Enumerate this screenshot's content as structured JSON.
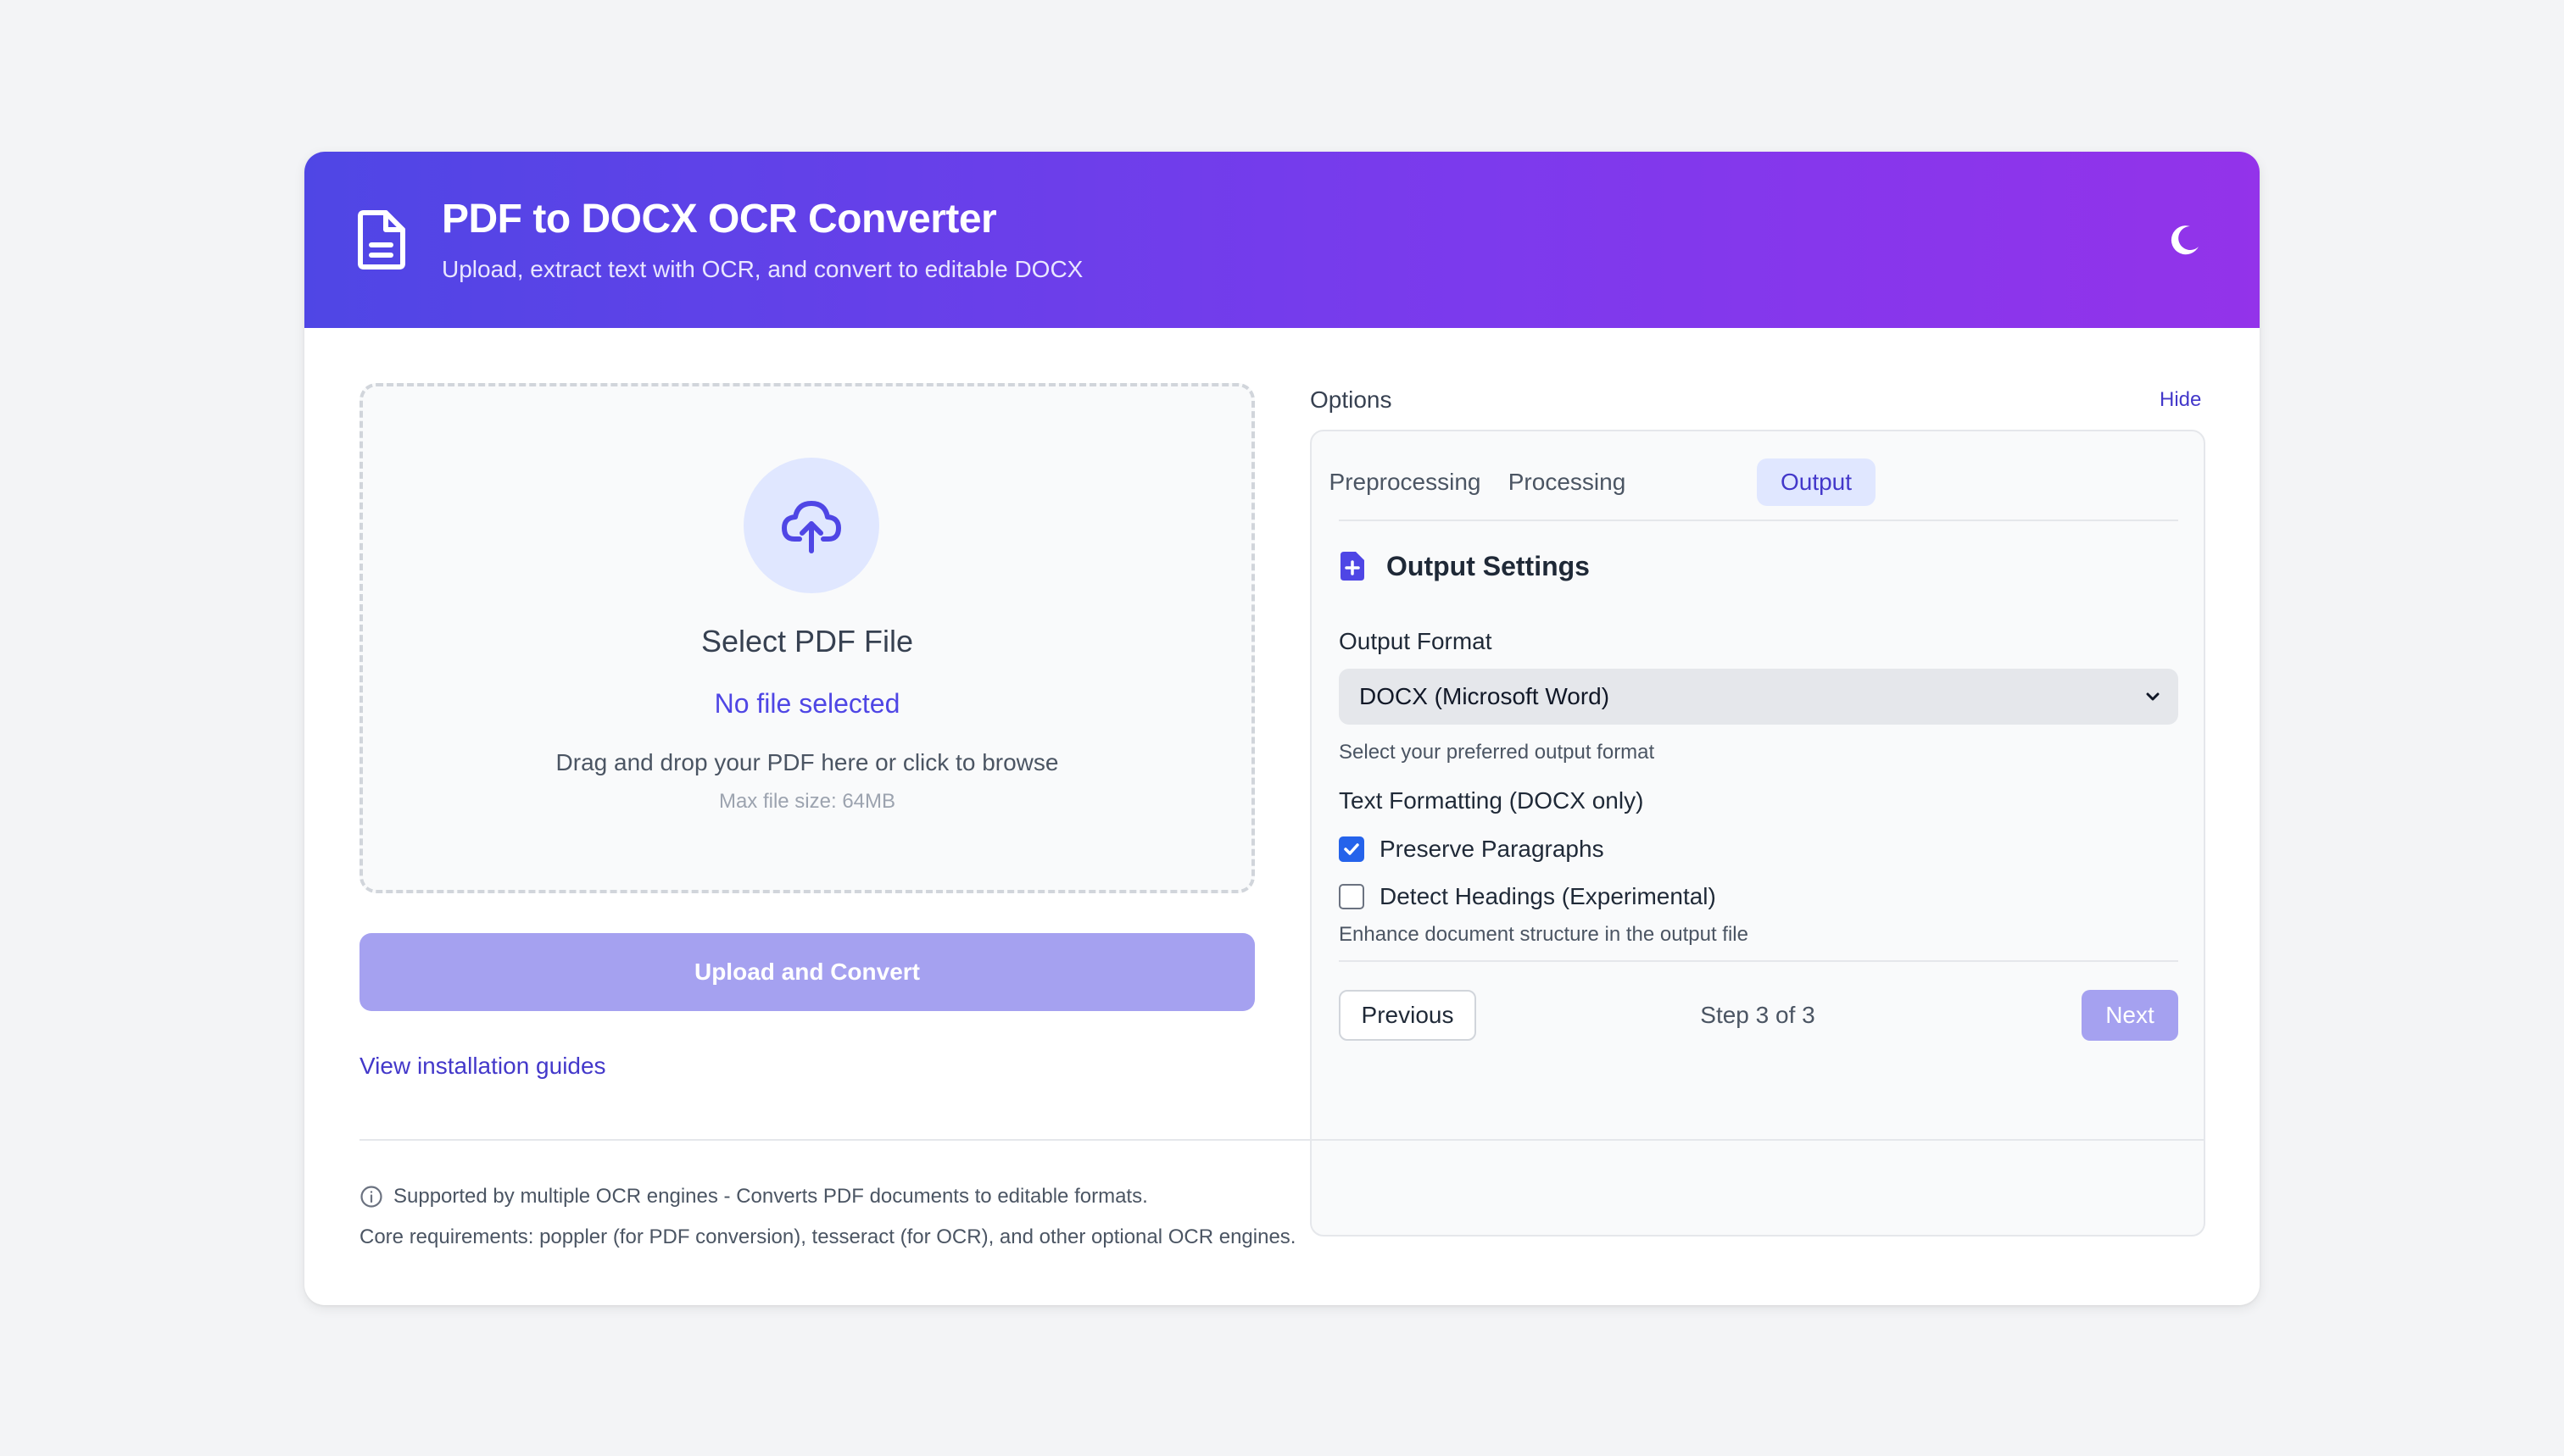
{
  "header": {
    "title": "PDF to DOCX OCR Converter",
    "subtitle": "Upload, extract text with OCR, and convert to editable DOCX",
    "logo_icon": "document-icon",
    "theme_toggle_icon": "moon-icon"
  },
  "upload": {
    "icon": "cloud-upload-icon",
    "title": "Select PDF File",
    "file_status": "No file selected",
    "help": "Drag and drop your PDF here or click to browse",
    "max_size": "Max file size: 64MB",
    "button_label": "Upload and Convert"
  },
  "links": {
    "install_guides": "View installation guides"
  },
  "options": {
    "label": "Options",
    "hide_label": "Hide",
    "tabs": [
      {
        "label": "Preprocessing",
        "active": false
      },
      {
        "label": "Processing",
        "active": false
      },
      {
        "label": "Output",
        "active": true
      }
    ],
    "section_title": "Output Settings",
    "section_icon": "file-plus-icon",
    "output_format": {
      "label": "Output Format",
      "value": "DOCX (Microsoft Word)",
      "help": "Select your preferred output format"
    },
    "text_formatting": {
      "label": "Text Formatting (DOCX only)",
      "checkboxes": [
        {
          "label": "Preserve Paragraphs",
          "checked": true
        },
        {
          "label": "Detect Headings (Experimental)",
          "checked": false
        }
      ],
      "help": "Enhance document structure in the output file"
    },
    "nav": {
      "previous": "Previous",
      "step": "Step 3 of 3",
      "next": "Next"
    }
  },
  "footer": {
    "info": "Supported by multiple OCR engines - Converts PDF documents to editable formats.",
    "requirements": "Core requirements: poppler (for PDF conversion), tesseract (for OCR), and other optional OCR engines.",
    "info_icon": "info-icon"
  },
  "colors": {
    "accent": "#4f46e5",
    "header_gradient_start": "#4f46e5",
    "header_gradient_end": "#9333ea",
    "disabled_button": "#a5a1f0",
    "checkbox_checked": "#2563eb"
  }
}
